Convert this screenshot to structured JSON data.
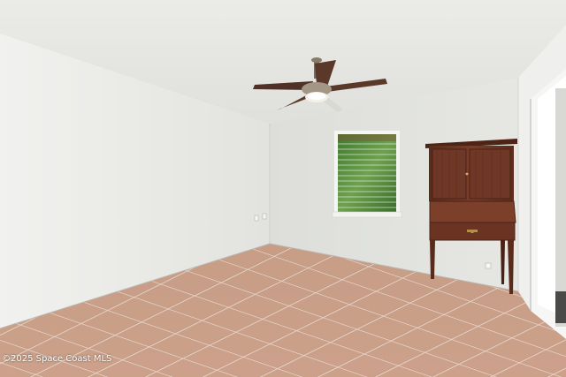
{
  "watermark": "©2025 Space Coast MLS",
  "colors": {
    "ceiling": "#e9e9e5",
    "left_wall": "#ececea",
    "back_wall": "#e3e4e0",
    "right_wall": "#eeeeec",
    "floor_tile": "#c79a82",
    "grout": "#efe9e2",
    "furniture_wood": "#6b3524",
    "window_foliage": "#4f8a3a"
  },
  "objects": [
    "ceiling-fan",
    "window-with-blinds",
    "secretary-cabinet",
    "terracotta-tile-floor",
    "open-doorway",
    "wall-outlet"
  ]
}
